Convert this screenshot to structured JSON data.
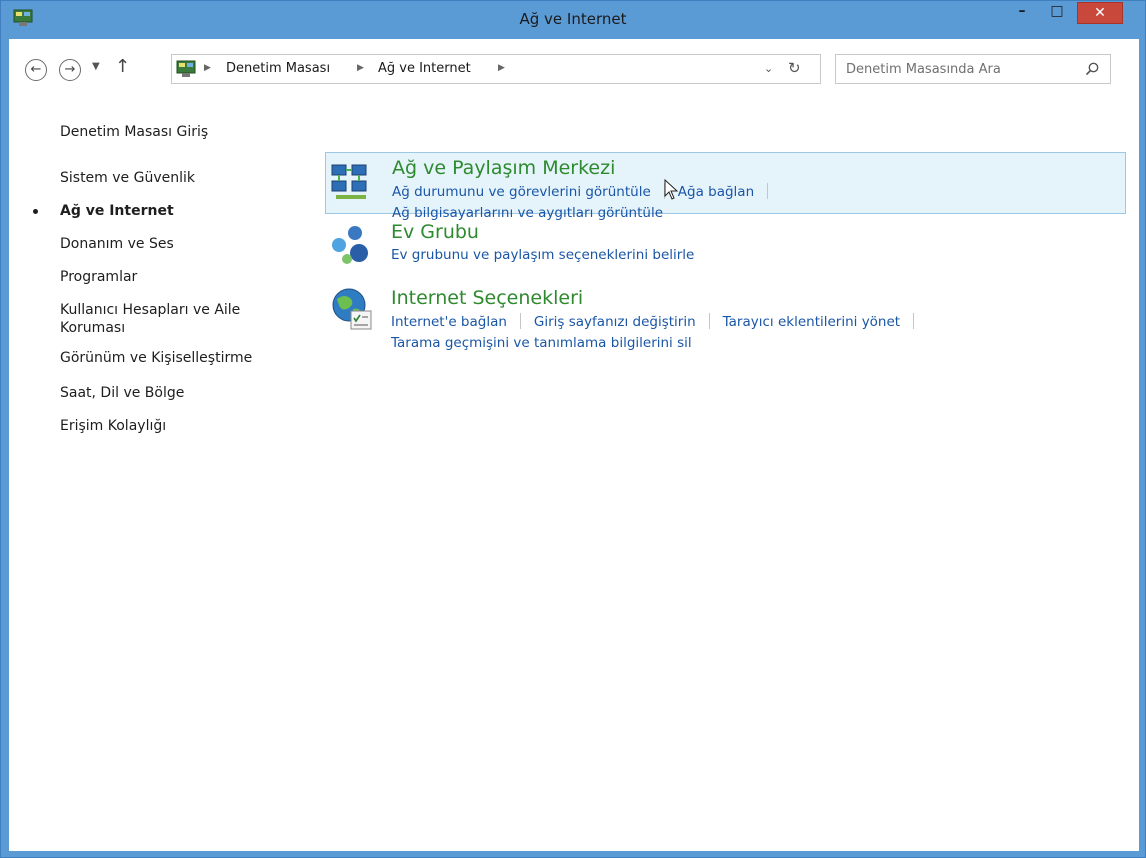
{
  "window": {
    "title": "Ağ ve Internet",
    "minimize_glyph": "–",
    "maximize_glyph": "□",
    "close_glyph": "✕",
    "accent": "#5b9bd5",
    "close_color": "#c9483c"
  },
  "address": {
    "crumbs": [
      "Denetim Masası",
      "Ağ ve Internet"
    ],
    "icon": "control-panel-icon"
  },
  "search": {
    "placeholder": "Denetim Masasında Ara"
  },
  "sidebar": {
    "items": [
      {
        "label": "Denetim Masası Giriş",
        "active": false
      },
      {
        "label": "Sistem ve Güvenlik",
        "active": false
      },
      {
        "label": "Ağ ve Internet",
        "active": true
      },
      {
        "label": "Donanım ve Ses",
        "active": false
      },
      {
        "label": "Programlar",
        "active": false
      },
      {
        "label": "Kullanıcı Hesapları ve Aile Koruması",
        "active": false
      },
      {
        "label": "Görünüm ve Kişiselleştirme",
        "active": false
      },
      {
        "label": "Saat, Dil ve Bölge",
        "active": false
      },
      {
        "label": "Erişim Kolaylığı",
        "active": false
      }
    ]
  },
  "categories": [
    {
      "title": "Ağ ve Paylaşım Merkezi",
      "icon": "network-sharing-icon",
      "links_row1": [
        "Ağ durumunu ve görevlerini görüntüle",
        "Ağa bağlan"
      ],
      "links_row2": [
        "Ağ bilgisayarlarını ve aygıtları görüntüle"
      ]
    },
    {
      "title": "Ev Grubu",
      "icon": "homegroup-icon",
      "links_row1": [
        "Ev grubunu ve paylaşım seçeneklerini belirle"
      ]
    },
    {
      "title": "Internet Seçenekleri",
      "icon": "internet-options-icon",
      "links_row1": [
        "Internet'e bağlan",
        "Giriş sayfanızı değiştirin",
        "Tarayıcı eklentilerini yönet"
      ],
      "links_row2": [
        "Tarama geçmişini ve tanımlama bilgilerini sil"
      ]
    }
  ],
  "colors": {
    "title_green": "#2e8a2e",
    "link_blue": "#1a56a6",
    "highlight_bg": "#e5f3fb"
  }
}
